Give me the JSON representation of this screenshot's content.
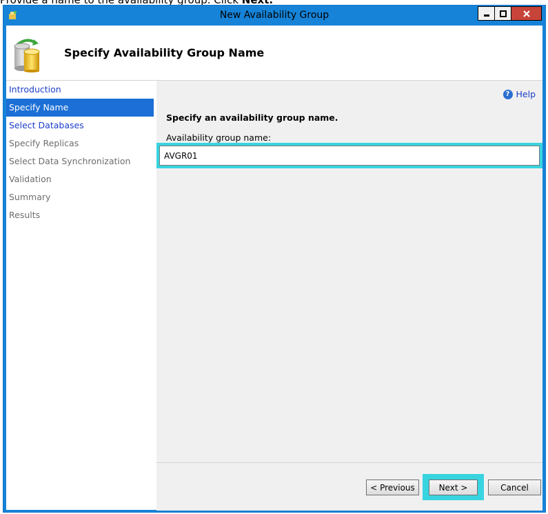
{
  "caption": {
    "text": "Provide a name to the availability group. Click ",
    "bold": "Next."
  },
  "window": {
    "title": "New Availability Group"
  },
  "header": {
    "title": "Specify Availability Group Name"
  },
  "nav": {
    "items": [
      {
        "label": "Introduction",
        "state": "link"
      },
      {
        "label": "Specify Name",
        "state": "active"
      },
      {
        "label": "Select Databases",
        "state": "link"
      },
      {
        "label": "Specify Replicas",
        "state": "disabled"
      },
      {
        "label": "Select Data Synchronization",
        "state": "disabled"
      },
      {
        "label": "Validation",
        "state": "disabled"
      },
      {
        "label": "Summary",
        "state": "disabled"
      },
      {
        "label": "Results",
        "state": "disabled"
      }
    ]
  },
  "content": {
    "help_label": "Help",
    "heading": "Specify an availability group name.",
    "field_label": "Availability group name:",
    "field_value": "AVGR01"
  },
  "buttons": {
    "previous": "< Previous",
    "next": "Next >",
    "cancel": "Cancel"
  },
  "colors": {
    "window_frame": "#1683d8",
    "highlight": "#38d4e0",
    "nav_active": "#1c6fd6",
    "link": "#1a3dc9"
  }
}
